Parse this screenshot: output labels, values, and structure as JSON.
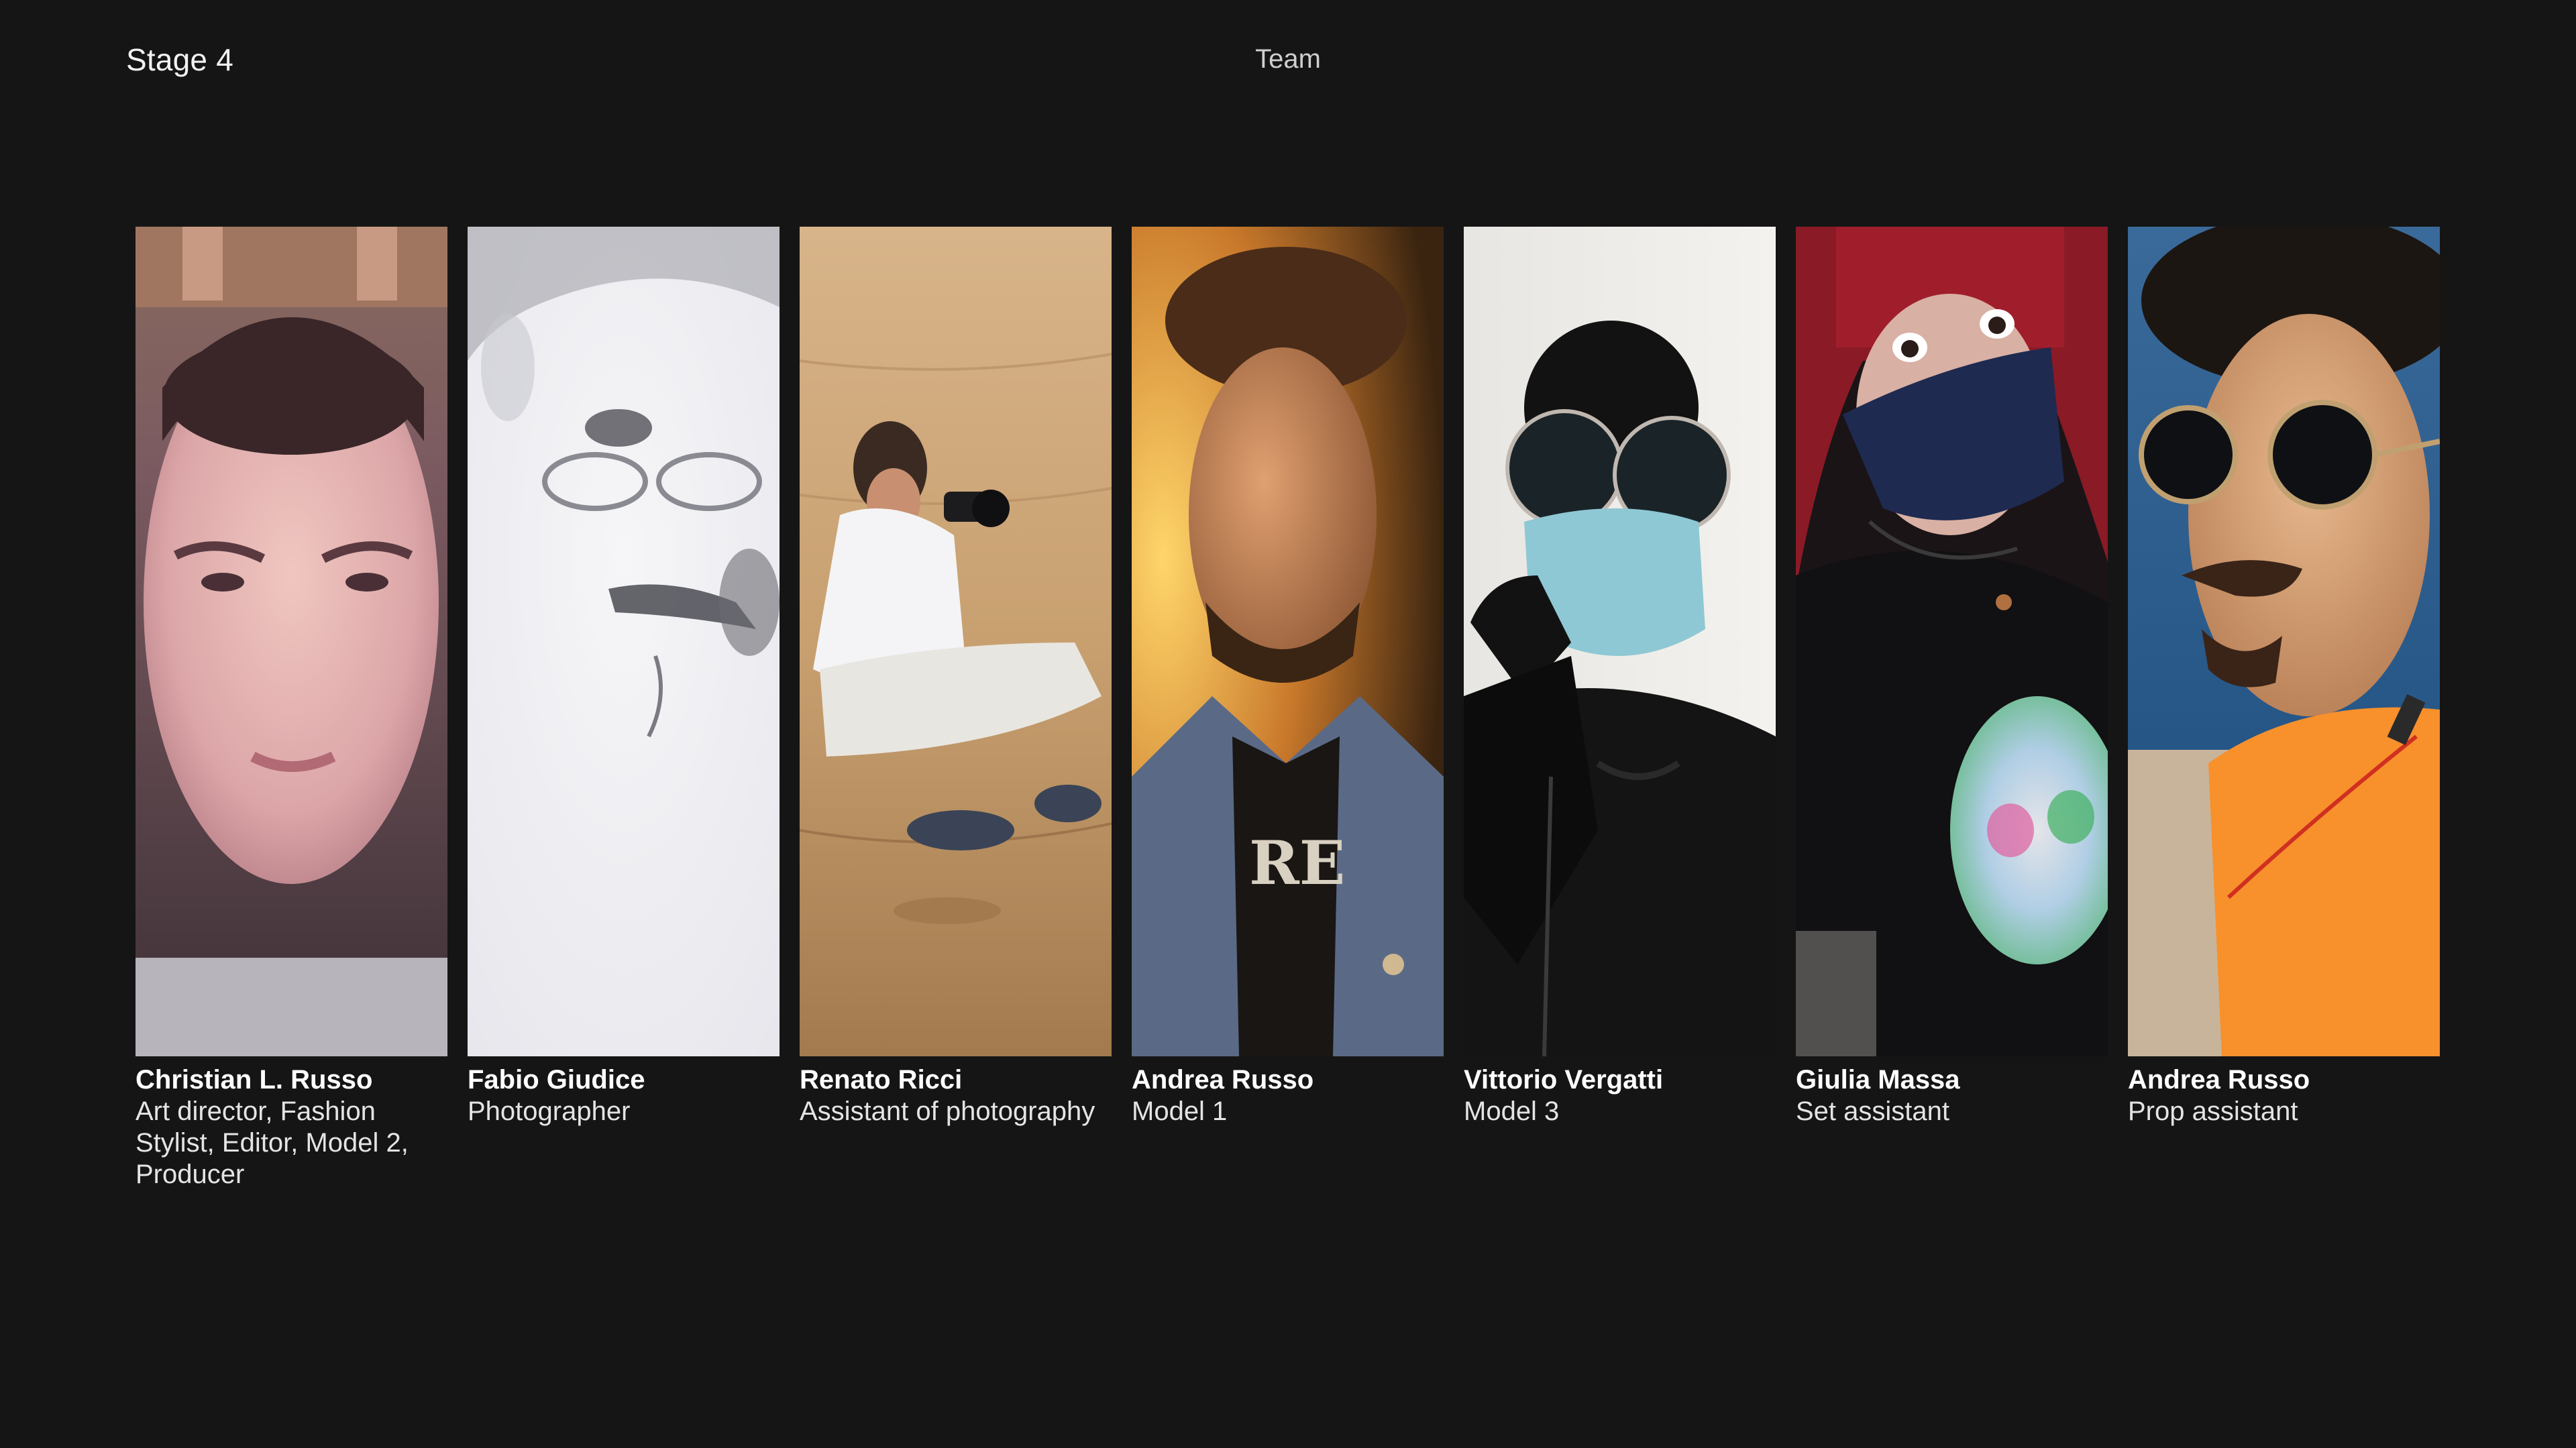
{
  "header": {
    "stage": "Stage 4",
    "title": "Team"
  },
  "team": [
    {
      "name": "Christian L. Russo",
      "role": "Art director, Fashion Stylist, Editor, Model 2, Producer"
    },
    {
      "name": "Fabio Giudice",
      "role": "Photographer"
    },
    {
      "name": "Renato Ricci",
      "role": "Assistant of photography"
    },
    {
      "name": "Andrea Russo",
      "role": "Model 1"
    },
    {
      "name": "Vittorio Vergatti",
      "role": "Model 3"
    },
    {
      "name": "Giulia Massa",
      "role": "Set assistant"
    },
    {
      "name": "Andrea Russo",
      "role": "Prop assistant"
    }
  ],
  "colors": {
    "background": "#151515",
    "text": "#ffffff",
    "muted": "#cfcfcf"
  }
}
